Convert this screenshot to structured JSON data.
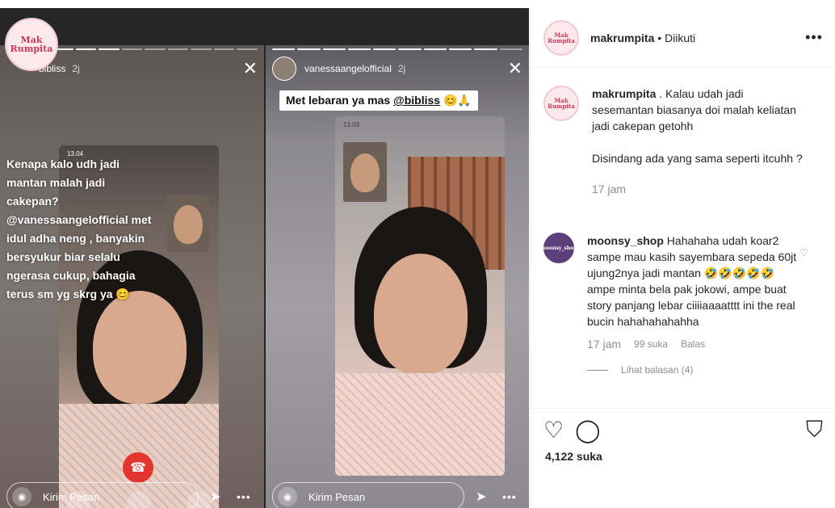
{
  "brand_logo": "Mak Rumpita",
  "story_left": {
    "username": "bibliss",
    "time": "2j",
    "overlay_text": "Kenapa kalo udh jadi mantan malah jadi cakepan? @vanessaangelofficial met idul adha neng , banyakin bersyukur biar selalu ngerasa cukup, bahagia terus sm yg skrg ya 😊",
    "phone_time": "13.04",
    "reply_placeholder": "Kirim Pesan"
  },
  "story_right": {
    "username": "vanessaangelofficial",
    "time": "2j",
    "caption_prefix": "Met lebaran ya mas ",
    "caption_mention": "@bibliss",
    "caption_suffix": " 😊🙏",
    "phone_time": "13.03",
    "reply_placeholder": "Kirim Pesan"
  },
  "post": {
    "account": "makrumpita",
    "follow_status": "• Diikuti",
    "caption_user": "makrumpita",
    "caption_text_1": ". Kalau udah jadi sesemantan biasanya doi malah keliatan jadi cakepan getohh",
    "caption_text_2": "Disindang ada yang sama seperti itcuhh ?",
    "caption_time": "17 jam",
    "comment_user": "moonsy_shop",
    "comment_text": "Hahahaha udah koar2 sampe mau kasih sayembara sepeda 60jt ujung2nya jadi mantan 🤣🤣🤣🤣🤣 ampe minta bela pak jokowi, ampe buat story panjang lebar ciiiiaaaatttt ini the real bucin hahahahahahha",
    "comment_time": "17 jam",
    "comment_likes": "99 suka",
    "reply_label": "Balas",
    "view_replies": "Lihat balasan (4)",
    "likes": "4,122 suka",
    "avatar_label": "Mak Rumpita",
    "commenter_avatar_label": "moonsy_shop"
  },
  "icons": [
    "close-icon",
    "camera-icon",
    "send-icon",
    "more-icon",
    "heart-icon",
    "comment-icon",
    "bookmark-icon"
  ]
}
